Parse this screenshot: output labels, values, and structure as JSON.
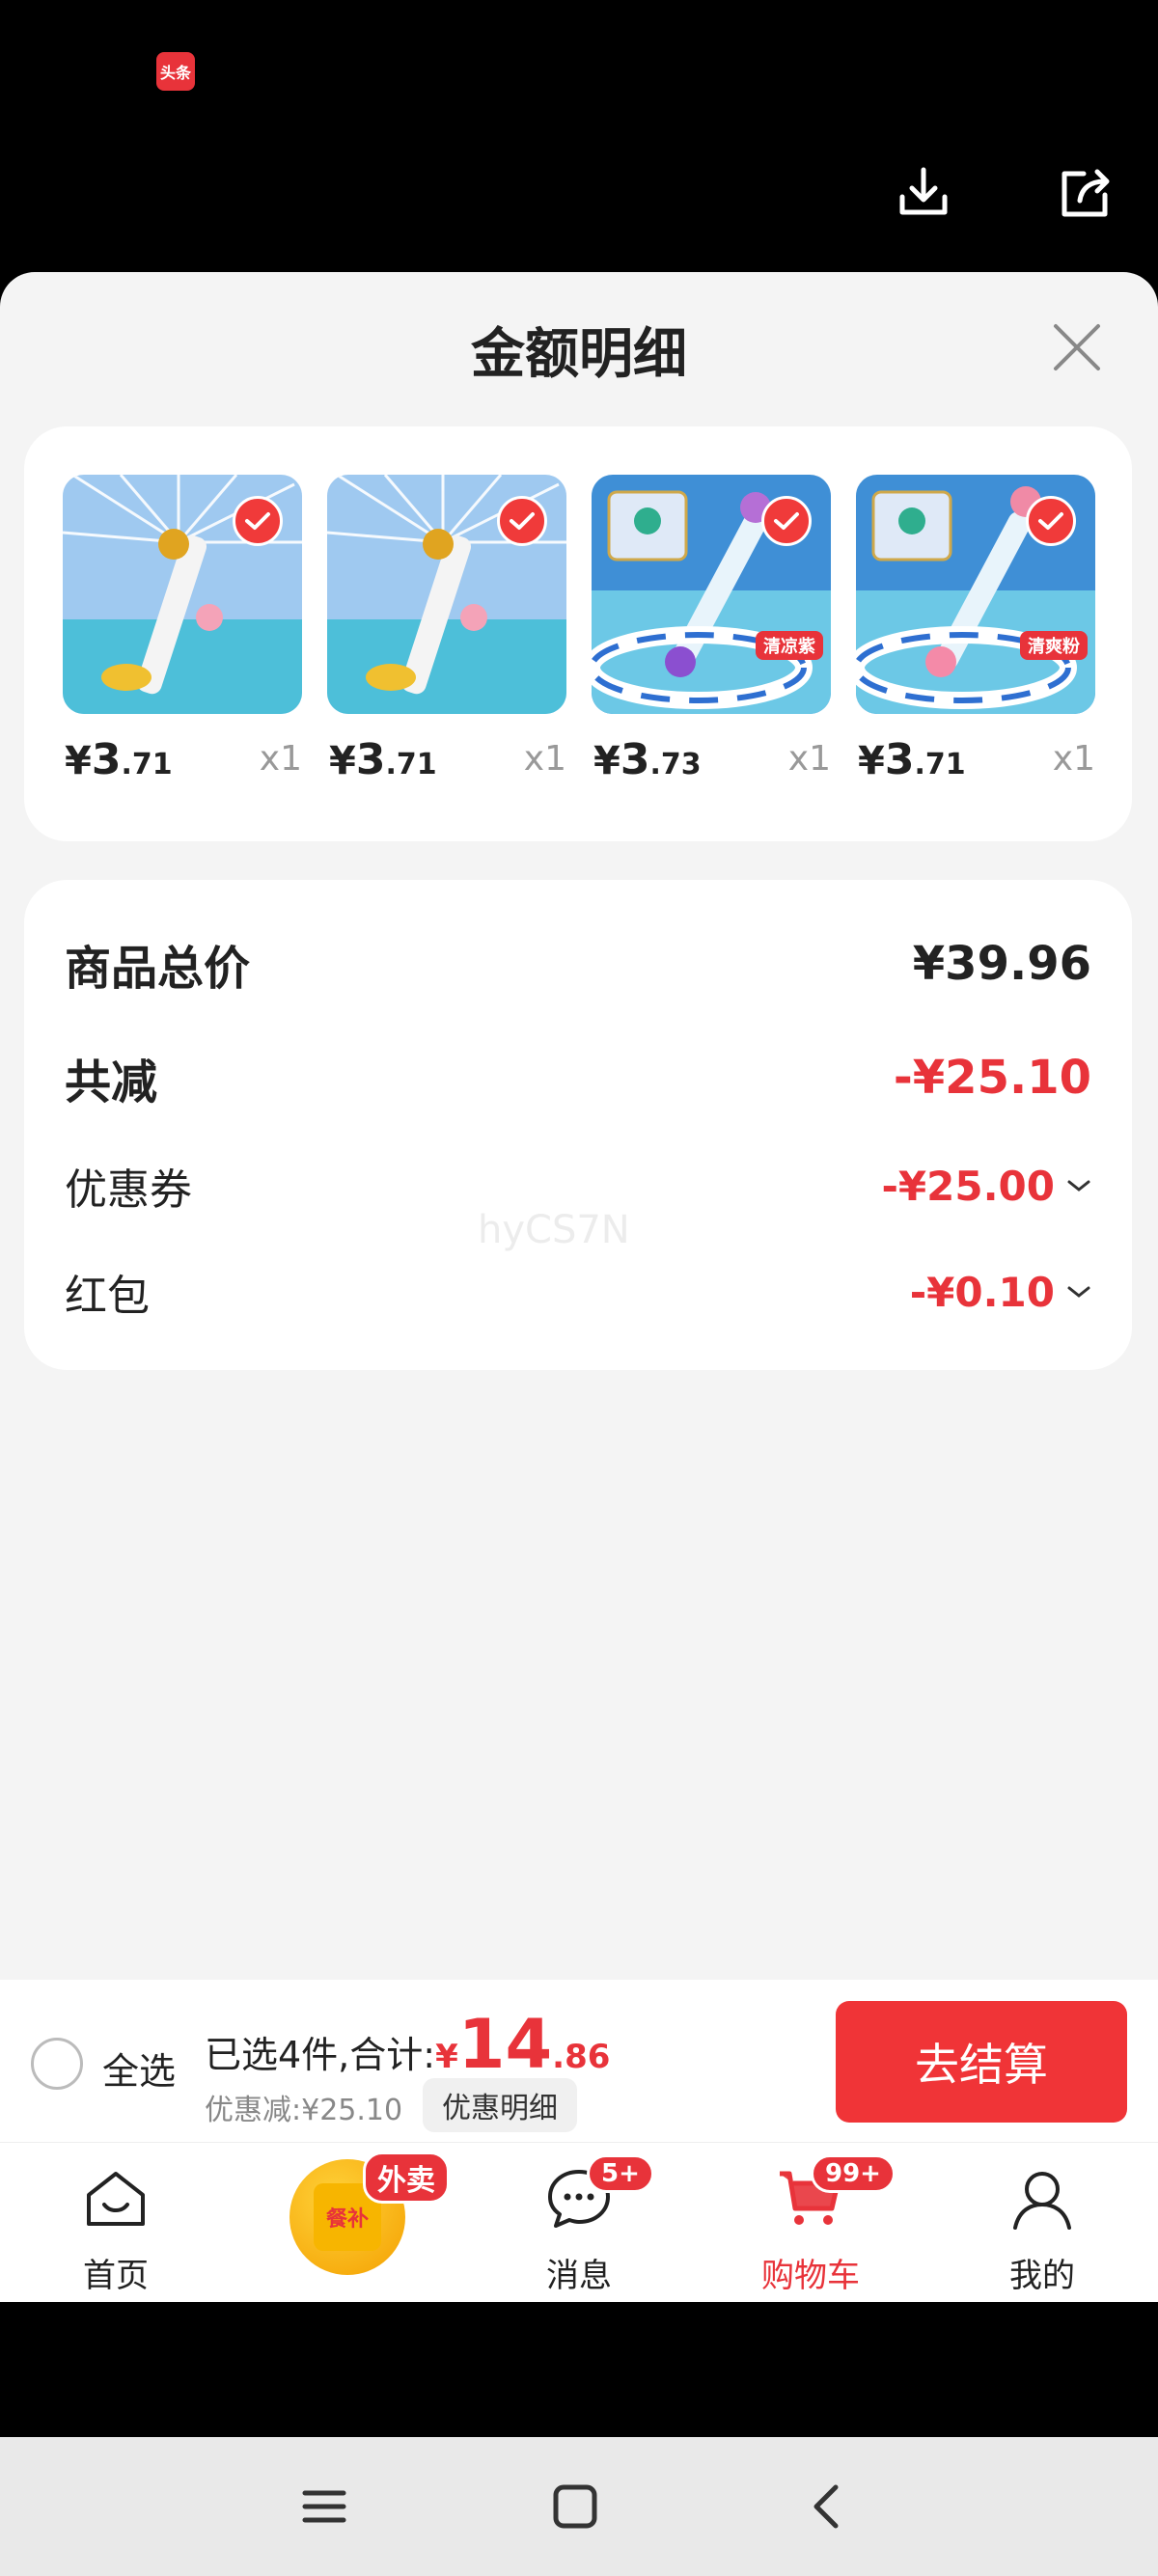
{
  "status_bar": {
    "app_badge": "头条"
  },
  "top_actions": {
    "download_icon": "download-icon",
    "share_icon": "share-icon"
  },
  "sheet": {
    "title": "金额明细",
    "close_icon": "close-icon",
    "products": [
      {
        "yen": "¥",
        "price_int": "3",
        "price_dec": ".71",
        "qty": "x1",
        "tag": ""
      },
      {
        "yen": "¥",
        "price_int": "3",
        "price_dec": ".71",
        "qty": "x1",
        "tag": ""
      },
      {
        "yen": "¥",
        "price_int": "3",
        "price_dec": ".73",
        "qty": "x1",
        "tag": "清凉紫"
      },
      {
        "yen": "¥",
        "price_int": "3",
        "price_dec": ".71",
        "qty": "x1",
        "tag": "清爽粉"
      }
    ],
    "summary": {
      "total_label": "商品总价",
      "total_value": "¥39.96",
      "reduce_label": "共减",
      "reduce_value": "-¥25.10",
      "coupon_label": "优惠券",
      "coupon_value": "-¥25.00",
      "redpacket_label": "红包",
      "redpacket_value": "-¥0.10"
    },
    "watermark": "hyCS7N"
  },
  "checkout": {
    "select_all": "全选",
    "selected_prefix": "已选4件,合计:",
    "total_yen": "¥",
    "total_int": "14",
    "total_dec": ".86",
    "discount_text": "优惠减:¥25.10",
    "detail_chip": "优惠明细",
    "checkout_button": "去结算"
  },
  "tabbar": {
    "home": "首页",
    "meal_badge": "外卖",
    "meal_text": "餐补",
    "messages": "消息",
    "messages_badge": "5+",
    "cart": "购物车",
    "cart_badge": "99+",
    "mine": "我的"
  },
  "colors": {
    "accent": "#e8333a",
    "background": "#f4f4f4"
  }
}
